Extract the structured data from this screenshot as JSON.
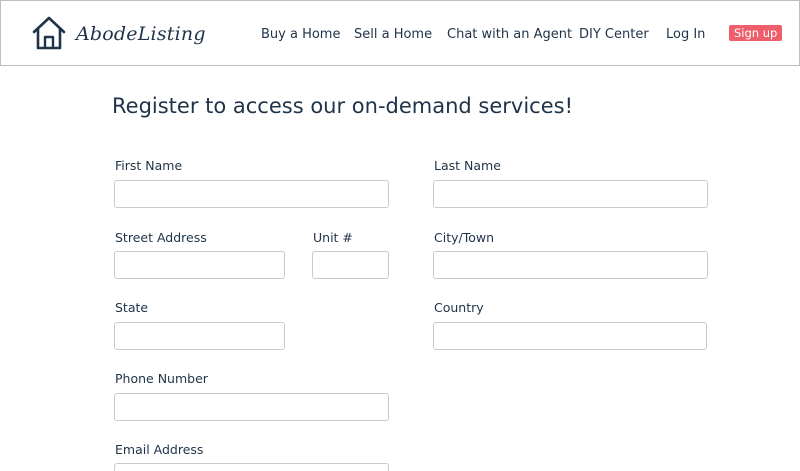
{
  "brand": {
    "name": "AbodeListing",
    "logo_icon": "house-icon"
  },
  "nav": {
    "items": [
      {
        "label": "Buy a Home"
      },
      {
        "label": "Sell a Home"
      },
      {
        "label": "Chat with an Agent"
      },
      {
        "label": "DIY Center"
      },
      {
        "label": "Log In"
      }
    ],
    "signup_label": "Sign up"
  },
  "form": {
    "title": "Register to access our on-demand services!",
    "fields": {
      "first_name": {
        "label": "First Name",
        "value": ""
      },
      "last_name": {
        "label": "Last Name",
        "value": ""
      },
      "street_address": {
        "label": "Street Address",
        "value": ""
      },
      "unit": {
        "label": "Unit #",
        "value": ""
      },
      "city": {
        "label": "City/Town",
        "value": ""
      },
      "state": {
        "label": "State",
        "value": ""
      },
      "country": {
        "label": "Country",
        "value": ""
      },
      "phone": {
        "label": "Phone Number",
        "value": ""
      },
      "email": {
        "label": "Email Address",
        "value": ""
      }
    }
  },
  "colors": {
    "text": "#1f3349",
    "signup_bg": "#ef5f6b",
    "border": "#c5cbd1"
  }
}
